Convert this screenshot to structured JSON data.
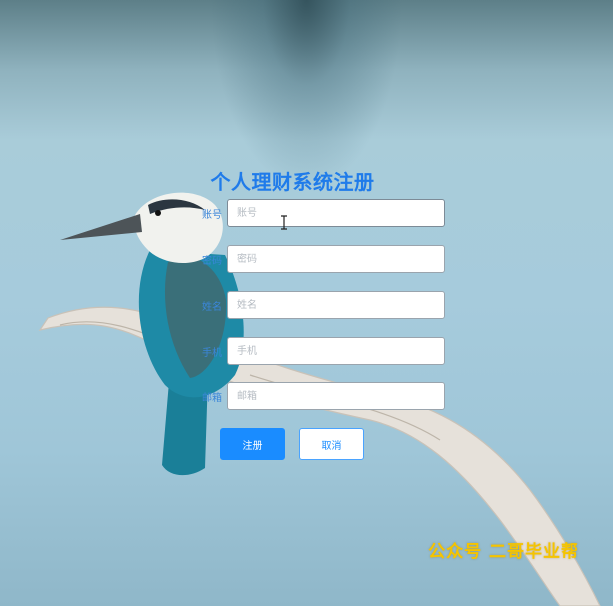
{
  "form": {
    "title": "个人理财系统注册",
    "fields": [
      {
        "label": "账号",
        "placeholder": "账号"
      },
      {
        "label": "密码",
        "placeholder": "密码"
      },
      {
        "label": "姓名",
        "placeholder": "姓名"
      },
      {
        "label": "手机",
        "placeholder": "手机"
      },
      {
        "label": "邮箱",
        "placeholder": "邮箱"
      }
    ],
    "submit_label": "注册",
    "cancel_label": "取消"
  },
  "watermark": "公众号 二哥毕业帮",
  "colors": {
    "accent": "#1a8cff",
    "title": "#1f7bea",
    "watermark": "#f5c400"
  }
}
